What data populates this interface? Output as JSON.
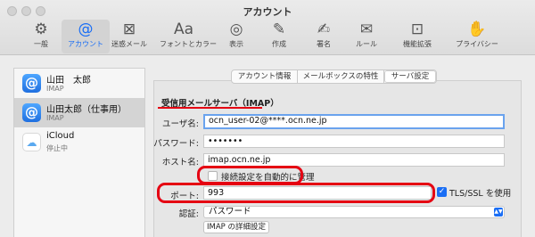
{
  "window": {
    "title": "アカウント"
  },
  "toolbar": {
    "items": [
      {
        "label": "一般",
        "icon": "gear-icon",
        "glyph": "⚙"
      },
      {
        "label": "アカウント",
        "icon": "at-icon",
        "glyph": "@"
      },
      {
        "label": "迷惑メール",
        "icon": "junk-mail-icon",
        "glyph": "⊠"
      },
      {
        "label": "フォントとカラー",
        "icon": "font-icon",
        "glyph": "Aa"
      },
      {
        "label": "表示",
        "icon": "eyeglasses-icon",
        "glyph": "◎"
      },
      {
        "label": "作成",
        "icon": "compose-icon",
        "glyph": "✎"
      },
      {
        "label": "署名",
        "icon": "signature-icon",
        "glyph": "✍"
      },
      {
        "label": "ルール",
        "icon": "rules-envelope-icon",
        "glyph": "✉"
      },
      {
        "label": "機能拡張",
        "icon": "extensions-icon",
        "glyph": "⊡"
      },
      {
        "label": "プライバシー",
        "icon": "hand-icon",
        "glyph": "✋"
      }
    ]
  },
  "sidebar": {
    "accounts": [
      {
        "name": "山田　太郎",
        "type": "IMAP",
        "glyph": "@"
      },
      {
        "name": "山田太郎（仕事用）",
        "type": "IMAP",
        "glyph": "@"
      },
      {
        "name": "iCloud",
        "type": "停止中",
        "glyph": "☁"
      }
    ]
  },
  "tabs": {
    "account_info": "アカウント情報",
    "mailbox": "メールボックスの特性",
    "server": "サーバ設定"
  },
  "form": {
    "section_title": "受信用メールサーバ（IMAP）",
    "username_label": "ユーザ名:",
    "username_value": "ocn_user-02@****.ocn.ne.jp",
    "password_label": "パスワード:",
    "password_value": "•••••••",
    "host_label": "ホスト名:",
    "host_value": "imap.ocn.ne.jp",
    "auto_manage_label": "接続設定を自動的に管理",
    "auto_manage_checked": false,
    "port_label": "ポート:",
    "port_value": "993",
    "tls_label": "TLS/SSL を使用",
    "tls_checked": true,
    "auth_label": "認証:",
    "auth_value": "パスワード",
    "imap_advanced_button": "IMAP の詳細設定"
  },
  "colors": {
    "accent": "#1a6ef5",
    "highlight_red": "#e50012"
  }
}
